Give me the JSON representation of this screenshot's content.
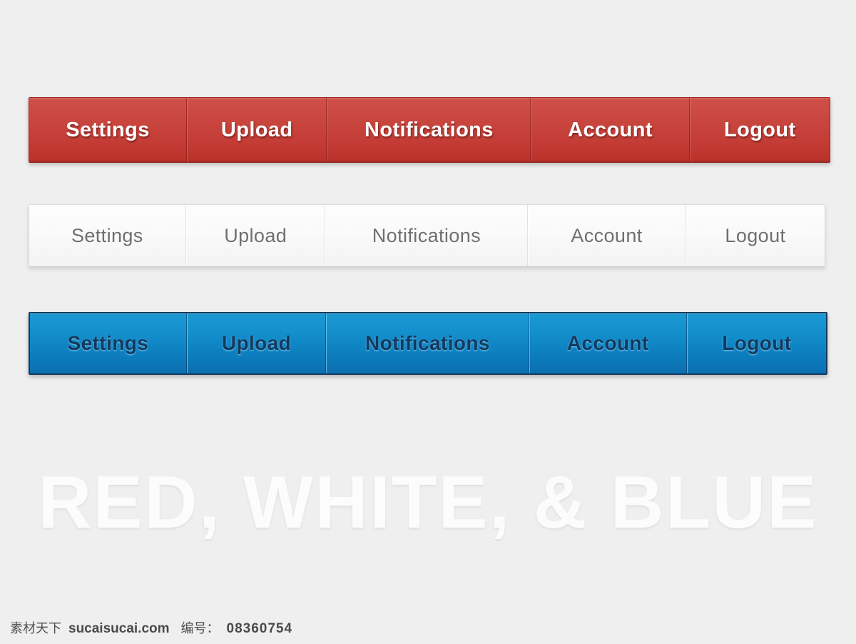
{
  "page": {
    "background_color": "#efefef",
    "headline": "RED, WHITE, & BLUE"
  },
  "navbars": [
    {
      "id": "red",
      "style_name": "red-navbar",
      "accent_color": "#c33b34",
      "border_color": "#a32724",
      "text_color": "#ffffff",
      "items": [
        {
          "label": "Settings"
        },
        {
          "label": "Upload"
        },
        {
          "label": "Notifications"
        },
        {
          "label": "Account"
        },
        {
          "label": "Logout"
        }
      ]
    },
    {
      "id": "white",
      "style_name": "white-navbar",
      "accent_color": "#fafafa",
      "border_color": "#dcdcdc",
      "text_color": "#6f6f6f",
      "items": [
        {
          "label": "Settings"
        },
        {
          "label": "Upload"
        },
        {
          "label": "Notifications"
        },
        {
          "label": "Account"
        },
        {
          "label": "Logout"
        }
      ]
    },
    {
      "id": "blue",
      "style_name": "blue-navbar",
      "accent_color": "#0d7fc0",
      "border_color": "#123a5e",
      "text_color": "#123a5e",
      "items": [
        {
          "label": "Settings"
        },
        {
          "label": "Upload"
        },
        {
          "label": "Notifications"
        },
        {
          "label": "Account"
        },
        {
          "label": "Logout"
        }
      ]
    }
  ],
  "watermark": {
    "brand_cn": "素材天下",
    "site": "sucaisucai.com",
    "code_label": "编号：",
    "code": "08360754"
  }
}
